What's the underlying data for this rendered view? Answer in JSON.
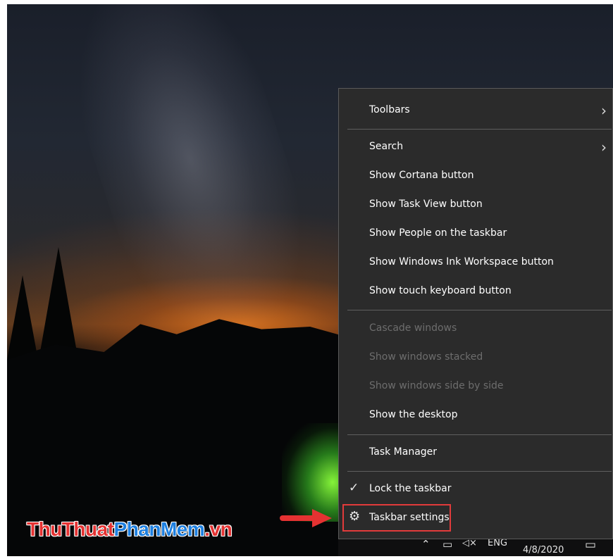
{
  "watermark": {
    "part1": "ThuThuat",
    "part2": "PhanMem",
    "part3": ".vn"
  },
  "menu": {
    "items": [
      {
        "label": "Toolbars",
        "submenu": true,
        "enabled": true
      },
      {
        "label": "Search",
        "submenu": true,
        "enabled": true
      },
      {
        "label": "Show Cortana button",
        "enabled": true
      },
      {
        "label": "Show Task View button",
        "enabled": true
      },
      {
        "label": "Show People on the taskbar",
        "enabled": true
      },
      {
        "label": "Show Windows Ink Workspace button",
        "enabled": true
      },
      {
        "label": "Show touch keyboard button",
        "enabled": true
      },
      {
        "label": "Cascade windows",
        "enabled": false
      },
      {
        "label": "Show windows stacked",
        "enabled": false
      },
      {
        "label": "Show windows side by side",
        "enabled": false
      },
      {
        "label": "Show the desktop",
        "enabled": true
      },
      {
        "label": "Task Manager",
        "enabled": true
      },
      {
        "label": "Lock the taskbar",
        "checked": true,
        "enabled": true
      },
      {
        "label": "Taskbar settings",
        "icon": "gear-icon",
        "enabled": true,
        "highlighted": true
      }
    ]
  },
  "tray": {
    "language": "ENG",
    "date": "4/8/2020",
    "icons": [
      "chevron-up-icon",
      "network-icon",
      "volume-muted-icon",
      "notification-icon"
    ]
  },
  "colors": {
    "menu_bg": "#2b2b2b",
    "highlight_border": "#e23b3b",
    "arrow": "#e53232"
  }
}
